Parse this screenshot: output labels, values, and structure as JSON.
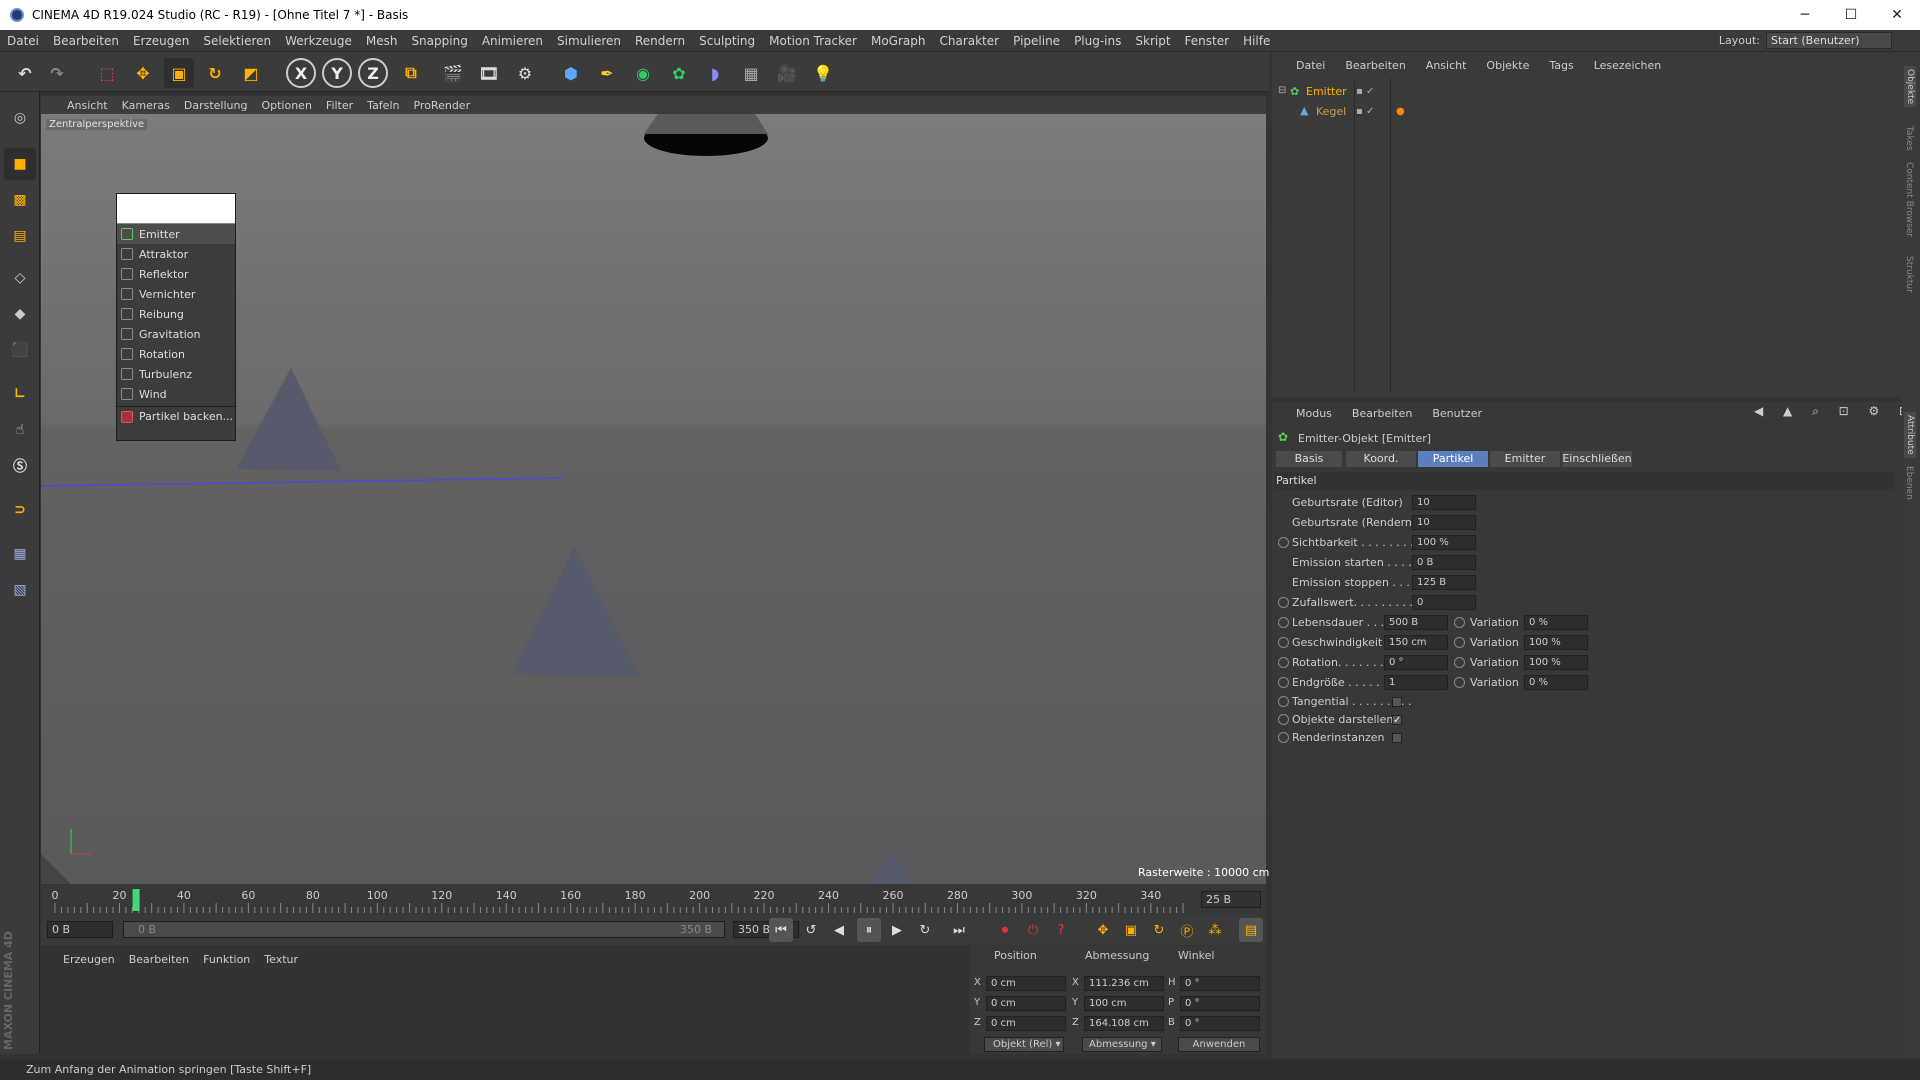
{
  "window": {
    "title": "CINEMA 4D R19.024 Studio (RC - R19) - [Ohne Titel 7 *] - Basis",
    "minimize": "─",
    "maximize": "☐",
    "close": "✕"
  },
  "menu": [
    "Datei",
    "Bearbeiten",
    "Erzeugen",
    "Selektieren",
    "Werkzeuge",
    "Mesh",
    "Snapping",
    "Animieren",
    "Simulieren",
    "Rendern",
    "Sculpting",
    "Motion Tracker",
    "MoGraph",
    "Charakter",
    "Pipeline",
    "Plug-ins",
    "Skript",
    "Fenster",
    "Hilfe"
  ],
  "layout": {
    "label": "Layout:",
    "value": "Start (Benutzer)"
  },
  "toolbar_xyz": [
    "X",
    "Y",
    "Z"
  ],
  "viewport": {
    "menu": [
      "Ansicht",
      "Kameras",
      "Darstellung",
      "Optionen",
      "Filter",
      "Tafeln",
      "ProRender"
    ],
    "label": "Zentralperspektive",
    "raster": "Rasterweite : 10000 cm"
  },
  "popup": {
    "items": [
      "Emitter",
      "Attraktor",
      "Reflektor",
      "Vernichter",
      "Reibung",
      "Gravitation",
      "Rotation",
      "Turbulenz",
      "Wind",
      "Partikel backen..."
    ]
  },
  "timeline": {
    "ticks": [
      "0",
      "20",
      "40",
      "60",
      "80",
      "100",
      "120",
      "140",
      "160",
      "180",
      "200",
      "220",
      "240",
      "260",
      "280",
      "300",
      "320",
      "340"
    ],
    "current_frame": 25,
    "end_frame": "25 B"
  },
  "transport": {
    "start_field": "0 B",
    "range_start": "0 B",
    "range_end": "350 B",
    "end_field": "350 B"
  },
  "material": {
    "menu": [
      "Erzeugen",
      "Bearbeiten",
      "Funktion",
      "Textur"
    ]
  },
  "coords": {
    "headers": [
      "Position",
      "Abmessung",
      "Winkel"
    ],
    "rows": [
      {
        "axis": "X",
        "pos": "0 cm",
        "size_axis": "X",
        "size": "111.236 cm",
        "rot_axis": "H",
        "rot": "0 °"
      },
      {
        "axis": "Y",
        "pos": "0 cm",
        "size_axis": "Y",
        "size": "100 cm",
        "rot_axis": "P",
        "rot": "0 °"
      },
      {
        "axis": "Z",
        "pos": "0 cm",
        "size_axis": "Z",
        "size": "164.108 cm",
        "rot_axis": "B",
        "rot": "0 °"
      }
    ],
    "mode": "Objekt (Rel)",
    "size_mode": "Abmessung",
    "apply": "Anwenden"
  },
  "status": "Zum Anfang der Animation springen [Taste Shift+F]",
  "branding": "MAXON CINEMA 4D",
  "objects": {
    "menu": [
      "Datei",
      "Bearbeiten",
      "Ansicht",
      "Objekte",
      "Tags",
      "Lesezeichen"
    ],
    "items": [
      {
        "name": "Emitter"
      },
      {
        "name": "Kegel"
      }
    ]
  },
  "attributes": {
    "menu": [
      "Modus",
      "Bearbeiten",
      "Benutzer"
    ],
    "title": "Emitter-Objekt [Emitter]",
    "tabs": [
      "Basis",
      "Koord.",
      "Partikel",
      "Emitter",
      "Einschließen"
    ],
    "active_tab": "Partikel",
    "section": "Partikel",
    "rows": [
      {
        "label": "Geburtsrate (Editor)",
        "value": "10"
      },
      {
        "label": "Geburtsrate (Rendern)",
        "value": "10"
      },
      {
        "label": "Sichtbarkeit . . . . . . . . .",
        "value": "100 %"
      },
      {
        "label": "Emission starten . . . . .",
        "value": "0 B"
      },
      {
        "label": "Emission stoppen . . . .",
        "value": "125 B"
      },
      {
        "label": "Zufallswert. . . . . . . . . . .",
        "value": "0"
      }
    ],
    "var_rows": [
      {
        "label": "Lebensdauer . . .",
        "value": "500 B",
        "var_label": "Variation",
        "var": "0 %"
      },
      {
        "label": "Geschwindigkeit",
        "value": "150 cm",
        "var_label": "Variation",
        "var": "100 %"
      },
      {
        "label": "Rotation. . . . . . .",
        "value": "0 °",
        "var_label": "Variation",
        "var": "100 %"
      },
      {
        "label": "Endgröße . . . . . .",
        "value": "1",
        "var_label": "Variation",
        "var": "0 %"
      }
    ],
    "checks": [
      {
        "label": "Tangential . . . . . . . . .",
        "checked": ""
      },
      {
        "label": "Objekte darstellen",
        "checked": "✓"
      },
      {
        "label": "Renderinstanzen",
        "checked": ""
      }
    ]
  },
  "side_tabs": [
    "Objekte",
    "Takes",
    "Content Browser",
    "Struktur",
    "Attribute",
    "Ebenen"
  ]
}
